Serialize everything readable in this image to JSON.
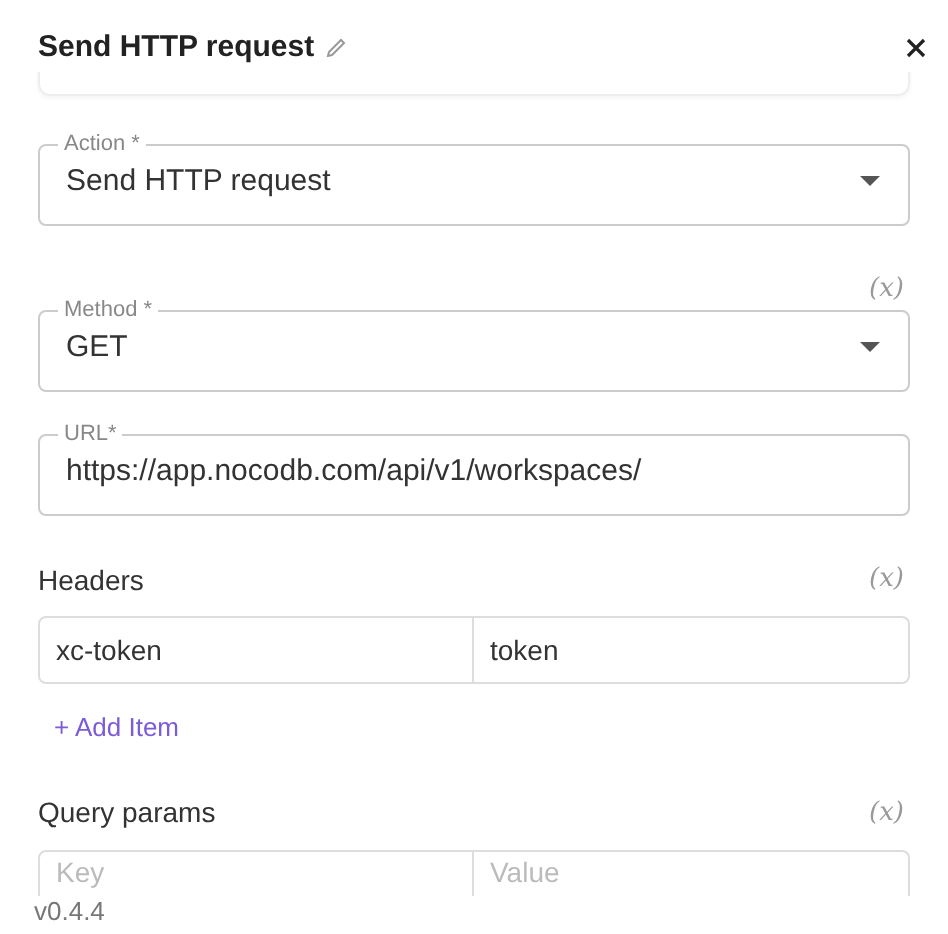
{
  "title": "Send HTTP request",
  "fields": [
    {
      "kind": "select",
      "label": "Action *",
      "value": "Send HTTP request"
    },
    {
      "kind": "select",
      "label": "Method *",
      "value": "GET",
      "variable_button": "(x)"
    },
    {
      "kind": "text",
      "label": "URL*",
      "value": "https://app.nocodb.com/api/v1/workspaces/"
    }
  ],
  "headers": {
    "label": "Headers",
    "variable_button": "(x)",
    "rows": [
      {
        "key": "xc-token",
        "value": "token"
      }
    ],
    "add_item": "+ Add Item"
  },
  "query_params": {
    "label": "Query params",
    "variable_button": "(x)",
    "rows": [
      {
        "key_placeholder": "Key",
        "value_placeholder": "Value"
      }
    ]
  },
  "version": "v0.4.4"
}
